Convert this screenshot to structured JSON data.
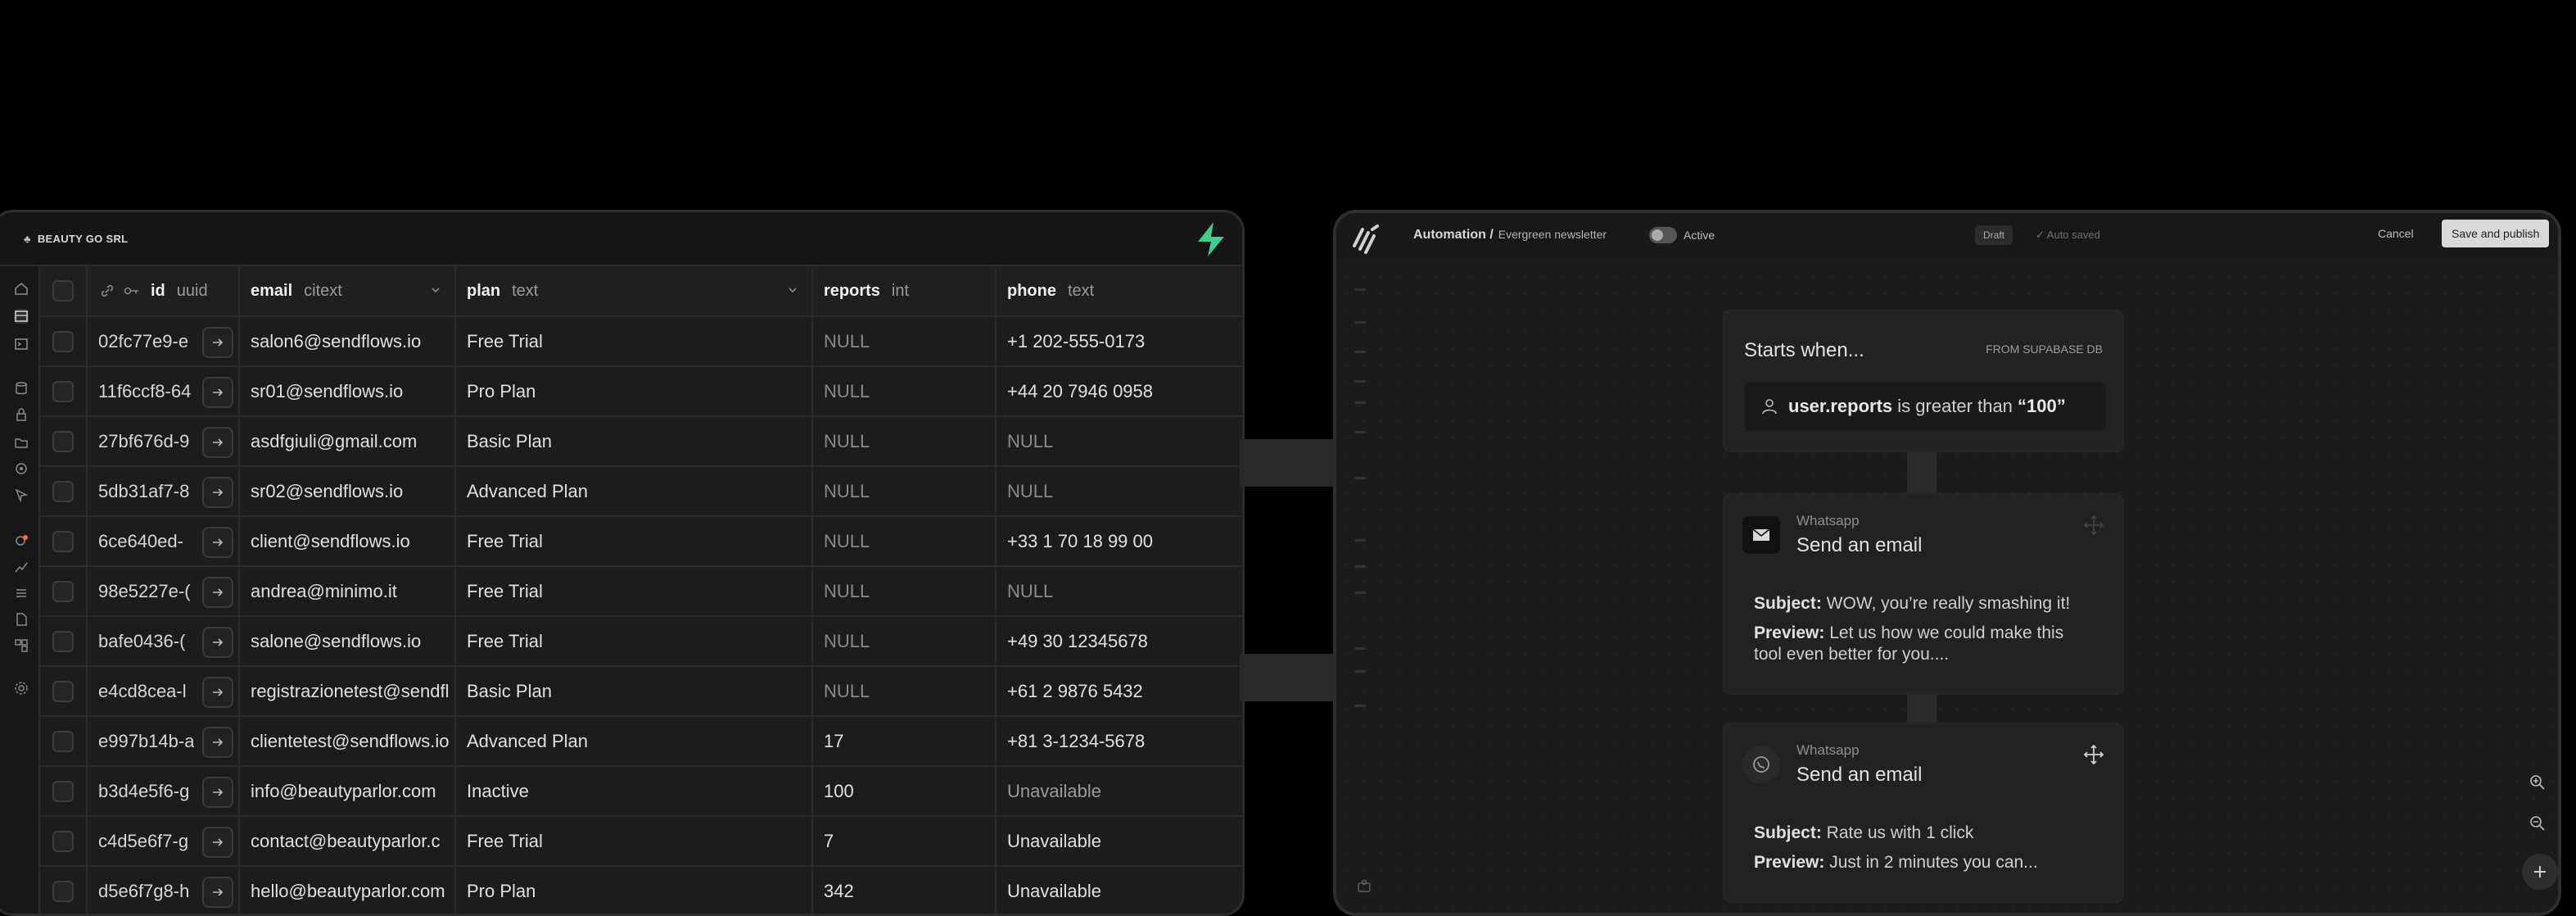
{
  "db": {
    "org_name": "BEAUTY GO SRL",
    "columns": {
      "id": {
        "name": "id",
        "type": "uuid"
      },
      "email": {
        "name": "email",
        "type": "citext"
      },
      "plan": {
        "name": "plan",
        "type": "text"
      },
      "reports": {
        "name": "reports",
        "type": "int"
      },
      "phone": {
        "name": "phone",
        "type": "text"
      }
    },
    "rows": [
      {
        "id": "02fc77e9-e",
        "email": "salon6@sendflows.io",
        "plan": "Free Trial",
        "reports": "NULL",
        "phone": "+1 202-555-0173"
      },
      {
        "id": "11f6ccf8-64",
        "email": "sr01@sendflows.io",
        "plan": "Pro Plan",
        "reports": "NULL",
        "phone": "+44 20 7946 0958"
      },
      {
        "id": "27bf676d-9",
        "email": "asdfgiuli@gmail.com",
        "plan": "Basic Plan",
        "reports": "NULL",
        "phone": "NULL"
      },
      {
        "id": "5db31af7-8",
        "email": "sr02@sendflows.io",
        "plan": "Advanced Plan",
        "reports": "NULL",
        "phone": "NULL"
      },
      {
        "id": "6ce640ed-",
        "email": "client@sendflows.io",
        "plan": "Free Trial",
        "reports": "NULL",
        "phone": "+33 1 70 18 99 00"
      },
      {
        "id": "98e5227e-(",
        "email": "andrea@minimo.it",
        "plan": "Free Trial",
        "reports": "NULL",
        "phone": "NULL"
      },
      {
        "id": "bafe0436-(",
        "email": "salone@sendflows.io",
        "plan": "Free Trial",
        "reports": "NULL",
        "phone": "+49 30 12345678"
      },
      {
        "id": "e4cd8cea-l",
        "email": "registrazionetest@sendfl",
        "plan": "Basic Plan",
        "reports": "NULL",
        "phone": "+61 2 9876 5432"
      },
      {
        "id": "e997b14b-a",
        "email": "clientetest@sendflows.io",
        "plan": "Advanced Plan",
        "reports": "17",
        "phone": "+81 3-1234-5678"
      },
      {
        "id": "b3d4e5f6-g",
        "email": "info@beautyparlor.com",
        "plan": "Inactive",
        "reports": "100",
        "phone": "Unavailable"
      },
      {
        "id": "c4d5e6f7-g",
        "email": "contact@beautyparlor.c",
        "plan": "Free Trial",
        "reports": "7",
        "phone": "Unavailable"
      },
      {
        "id": "d5e6f7g8-h",
        "email": "hello@beautyparlor.com",
        "plan": "Pro Plan",
        "reports": "342",
        "phone": "Unavailable"
      }
    ]
  },
  "automation": {
    "breadcrumb_root": "Automation /",
    "breadcrumb_current": "Evergreen newsletter",
    "toggle_label": "Active",
    "status_badge": "Draft",
    "autosave_text": "✓ Auto saved",
    "cancel_label": "Cancel",
    "save_label": "Save and publish",
    "trigger": {
      "title": "Starts when...",
      "source": "FROM SUPABASE DB",
      "field": "user.reports",
      "operator": " is greater than ",
      "value": "“100”"
    },
    "steps": [
      {
        "channel": "Whatsapp",
        "title": "Send an email",
        "subject_label": "Subject:",
        "subject": " WOW, you’re really smashing it!",
        "preview_label": "Preview:",
        "preview": " Let us how we could make this tool even better for you...."
      },
      {
        "channel": "Whatsapp",
        "title": "Send an email",
        "subject_label": "Subject:",
        "subject": " Rate us with 1 click",
        "preview_label": "Preview:",
        "preview": " Just in 2 minutes you can..."
      }
    ]
  },
  "colors": {
    "brand_green": "#3ecf8e",
    "background": "#000000",
    "panel": "#1c1c1c"
  }
}
